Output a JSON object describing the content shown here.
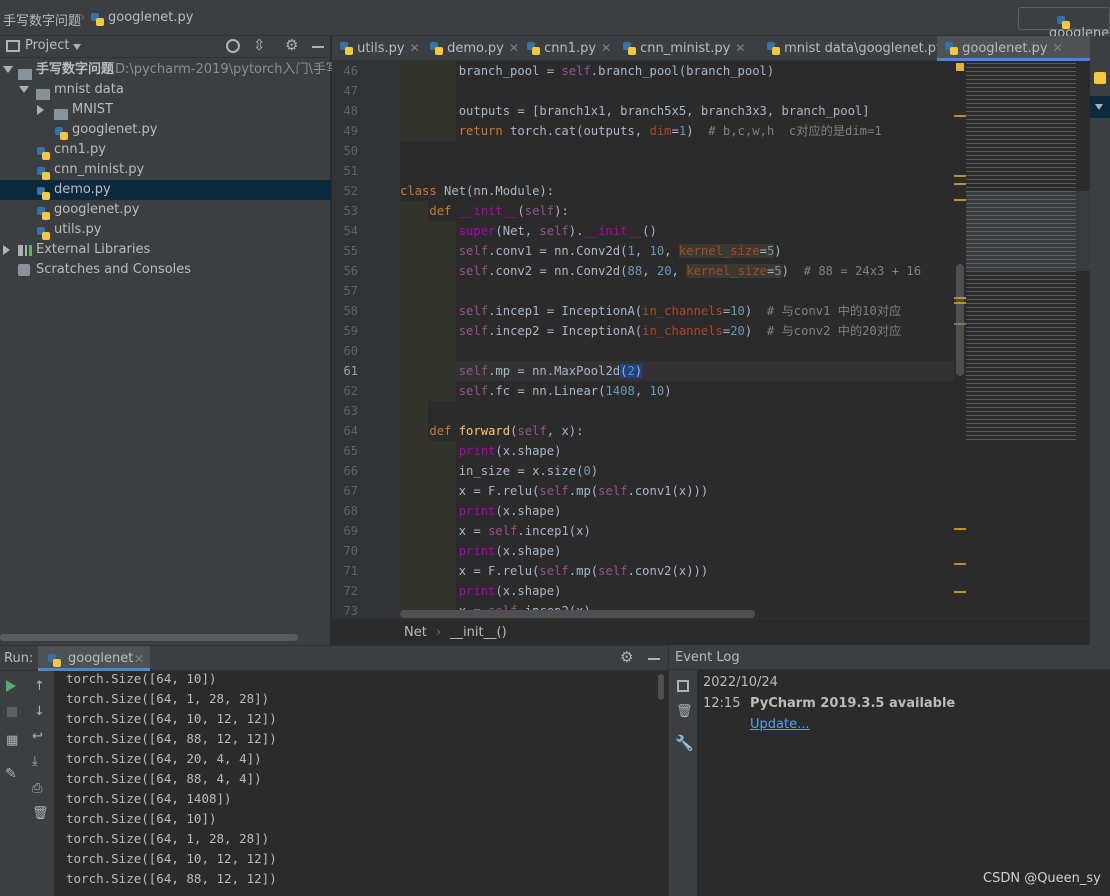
{
  "nav": {
    "project_name": "手写数字问题",
    "file_name": "googlenet.py",
    "run_config": "googlenet"
  },
  "project": {
    "header": "Project",
    "root_name": "手写数字问题",
    "root_path": "D:\\pycharm-2019\\pytorch入门\\手写数字",
    "items": [
      {
        "label": "mnist data"
      },
      {
        "label": "MNIST"
      },
      {
        "label": "googlenet.py"
      },
      {
        "label": "cnn1.py"
      },
      {
        "label": "cnn_minist.py"
      },
      {
        "label": "demo.py"
      },
      {
        "label": "googlenet.py"
      },
      {
        "label": "utils.py"
      },
      {
        "label": "External Libraries"
      },
      {
        "label": "Scratches and Consoles"
      }
    ]
  },
  "tabs": [
    {
      "label": "utils.py"
    },
    {
      "label": "demo.py"
    },
    {
      "label": "cnn1.py"
    },
    {
      "label": "cnn_minist.py"
    },
    {
      "label": "mnist data\\googlenet.py"
    },
    {
      "label": "googlenet.py"
    }
  ],
  "right_tab": "Re",
  "editor": {
    "line_numbers": [
      "46",
      "47",
      "48",
      "49",
      "50",
      "51",
      "52",
      "53",
      "54",
      "55",
      "56",
      "57",
      "58",
      "59",
      "60",
      "61",
      "62",
      "63",
      "64",
      "65",
      "66",
      "67",
      "68",
      "69",
      "70",
      "71",
      "72",
      "73"
    ],
    "current_line": "61"
  },
  "breadcrumb": {
    "class_name": "Net",
    "method_name": "__init__()"
  },
  "run": {
    "label": "Run:",
    "tab": "googlenet",
    "output": [
      "torch.Size([64, 10])",
      "torch.Size([64, 1, 28, 28])",
      "torch.Size([64, 10, 12, 12])",
      "torch.Size([64, 88, 12, 12])",
      "torch.Size([64, 20, 4, 4])",
      "torch.Size([64, 88, 4, 4])",
      "torch.Size([64, 1408])",
      "torch.Size([64, 10])",
      "torch.Size([64, 1, 28, 28])",
      "torch.Size([64, 10, 12, 12])",
      "torch.Size([64, 88, 12, 12])"
    ]
  },
  "event_log": {
    "title": "Event Log",
    "date": "2022/10/24",
    "time": "12:15",
    "message": "PyCharm 2019.3.5 available",
    "link": "Update..."
  },
  "watermark": "CSDN @Queen_sy"
}
